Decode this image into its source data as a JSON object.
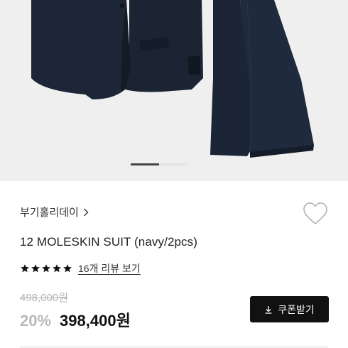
{
  "product": {
    "image_alt": "Navy moleskin suit jacket and trousers",
    "brand": "부기홀리데이",
    "title": "12 MOLESKIN SUIT (navy/2pcs)",
    "rating_stars": 5,
    "review_link": "16개 리뷰 보기",
    "original_price": "498,000원",
    "discount": "20%",
    "sale_price": "398,400원",
    "coupon_button": "쿠폰받기"
  },
  "carousel": {
    "active_slide": 1
  },
  "icons": {
    "brand_chevron": "chevron-right-icon",
    "wishlist": "heart-icon",
    "star": "star-icon",
    "download": "download-icon"
  },
  "colors": {
    "suit_navy": "#1a2433",
    "star": "#111111",
    "button_bg": "#111111",
    "muted_text": "#b5b5b5"
  }
}
